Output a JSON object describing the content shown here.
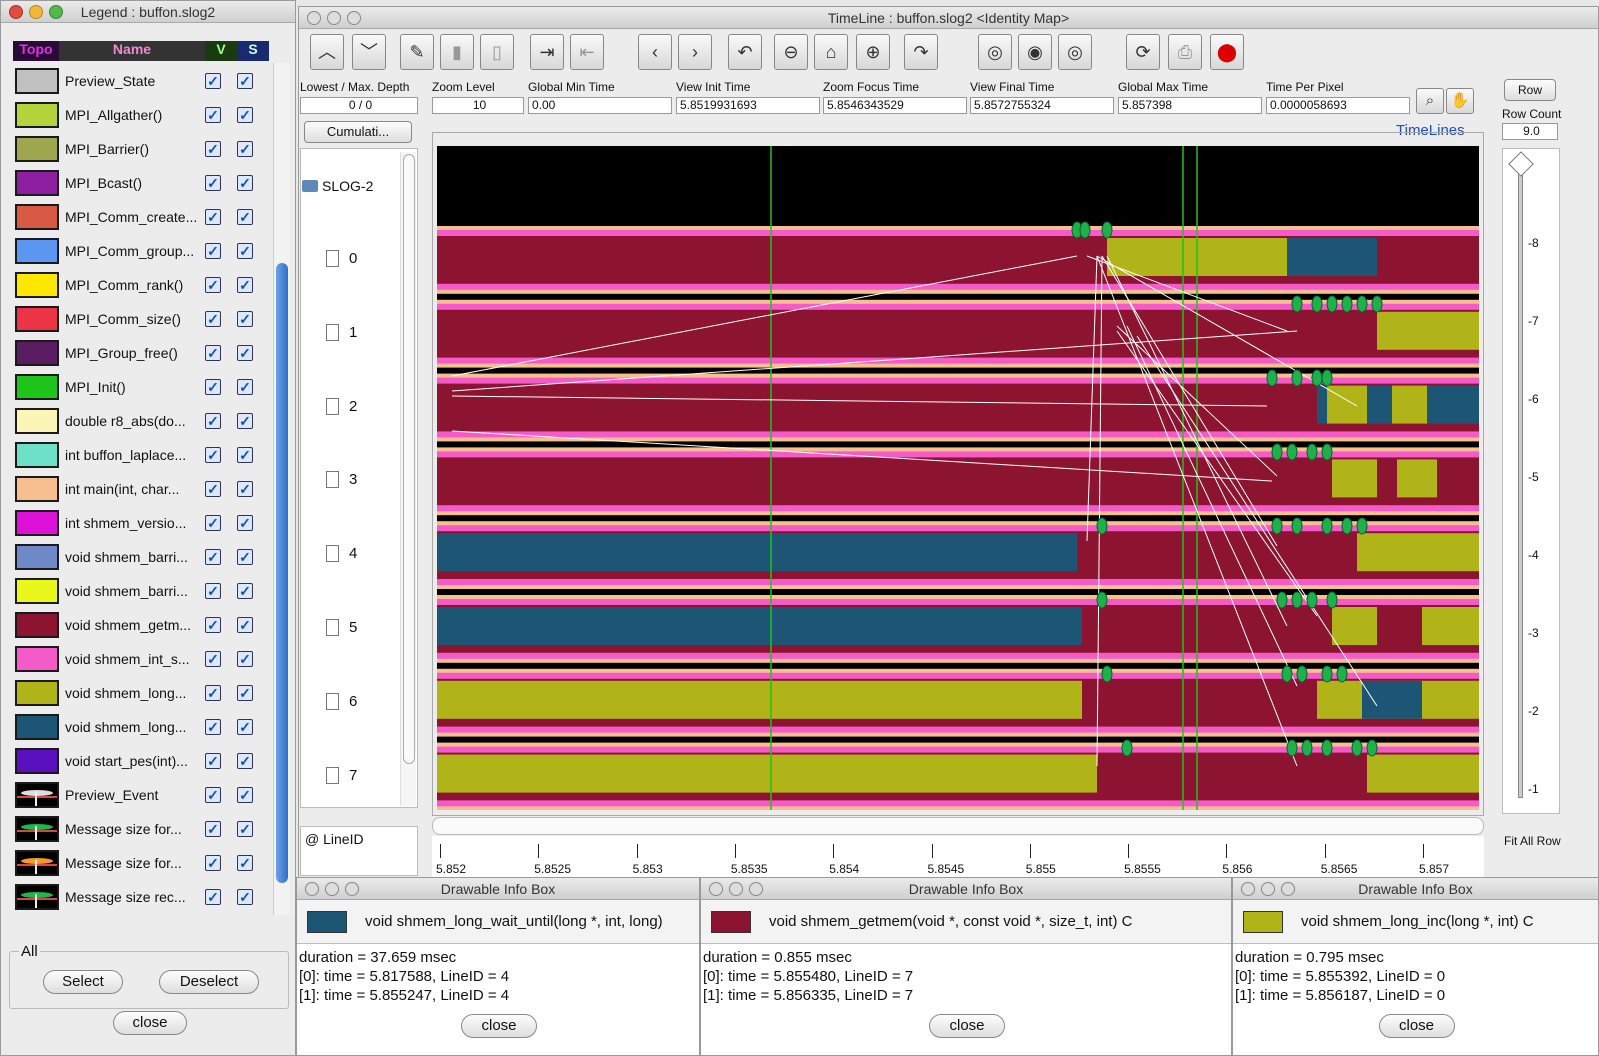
{
  "legend_window": {
    "title": "Legend : buffon.slog2",
    "col_topo": "Topo",
    "col_name": "Name",
    "col_v": "V",
    "col_s": "S",
    "items": [
      {
        "label": "Preview_State",
        "color": "#c0c0c0"
      },
      {
        "label": "MPI_Allgather()",
        "color": "#b5d33a"
      },
      {
        "label": "MPI_Barrier()",
        "color": "#9ea74e"
      },
      {
        "label": "MPI_Bcast()",
        "color": "#8e1fa0"
      },
      {
        "label": "MPI_Comm_create...",
        "color": "#d85a45"
      },
      {
        "label": "MPI_Comm_group...",
        "color": "#5b96f2"
      },
      {
        "label": "MPI_Comm_rank()",
        "color": "#ffe600"
      },
      {
        "label": "MPI_Comm_size()",
        "color": "#ec3447"
      },
      {
        "label": "MPI_Group_free()",
        "color": "#5a1d62"
      },
      {
        "label": "MPI_Init()",
        "color": "#1ec41a"
      },
      {
        "label": "double r8_abs(do...",
        "color": "#fbf6b8"
      },
      {
        "label": "int buffon_laplace...",
        "color": "#6fe0c8"
      },
      {
        "label": "int main(int, char...",
        "color": "#f7bf90"
      },
      {
        "label": "int shmem_versio...",
        "color": "#dd10d8"
      },
      {
        "label": "void shmem_barri...",
        "color": "#6f88c8"
      },
      {
        "label": "void shmem_barri...",
        "color": "#e9f71b"
      },
      {
        "label": "void shmem_getm...",
        "color": "#8c1430"
      },
      {
        "label": "void shmem_int_s...",
        "color": "#f45bc8"
      },
      {
        "label": "void shmem_long...",
        "color": "#b0b419"
      },
      {
        "label": "void shmem_long...",
        "color": "#1c5674"
      },
      {
        "label": "void start_pes(int)...",
        "color": "#5b10c0"
      },
      {
        "label": "Preview_Event",
        "color": "event-white"
      },
      {
        "label": "Message size for...",
        "color": "event-green"
      },
      {
        "label": "Message size for...",
        "color": "event-orange"
      },
      {
        "label": "Message size rec...",
        "color": "event-green2"
      }
    ],
    "all_label": "All",
    "select_label": "Select",
    "deselect_label": "Deselect",
    "close_label": "close"
  },
  "timeline_window": {
    "title": "TimeLine : buffon.slog2  <Identity Map>",
    "headers": {
      "depth": "Lowest / Max. Depth",
      "zoom": "Zoom Level",
      "gmin": "Global Min Time",
      "vinit": "View  Init Time",
      "zfocus": "Zoom Focus Time",
      "vfinal": "View Final Time",
      "gmax": "Global Max Time",
      "tpp": "Time Per Pixel"
    },
    "values": {
      "depth": "0 / 0",
      "zoom": "10",
      "gmin": "0.00",
      "vinit": "5.8519931693",
      "zfocus": "5.8546343529",
      "vfinal": "5.8572755324",
      "gmax": "5.857398",
      "tpp": "0.0000058693"
    },
    "row_label": "Row",
    "row_count_label": "Row Count",
    "row_count": "9.0",
    "cumulative": "Cumulati...",
    "timelines_label": "TimeLines",
    "tree_root": "SLOG-2",
    "rows": [
      "0",
      "1",
      "2",
      "3",
      "4",
      "5",
      "6",
      "7"
    ],
    "lineid_label": "@ LineID",
    "fit_all_rows": "Fit All Row",
    "axis_ticks": [
      "5.852",
      "5.8525",
      "5.853",
      "5.8535",
      "5.854",
      "5.8545",
      "5.855",
      "5.8555",
      "5.856",
      "5.8565",
      "5.857"
    ],
    "y_ticks": [
      "-8",
      "-7",
      "-6",
      "-5",
      "-4",
      "-3",
      "-2",
      "-1"
    ]
  },
  "info_boxes": [
    {
      "title": "Drawable Info Box",
      "name": "void shmem_long_wait_until(long *, int, long)",
      "color": "#1c5674",
      "duration": "duration = 37.659 msec",
      "line0": "[0]: time = 5.817588, LineID = 4",
      "line1": "[1]: time = 5.855247, LineID = 4",
      "close": "close"
    },
    {
      "title": "Drawable Info Box",
      "name": "void shmem_getmem(void *, const void *, size_t, int) C",
      "color": "#8c1430",
      "duration": "duration = 0.855 msec",
      "line0": "[0]: time = 5.855480, LineID = 7",
      "line1": "[1]: time = 5.856335, LineID = 7",
      "close": "close"
    },
    {
      "title": "Drawable Info Box",
      "name": "void shmem_long_inc(long *, int) C",
      "color": "#b0b419",
      "duration": "duration = 0.795 msec",
      "line0": "[0]: time = 5.855392, LineID = 0",
      "line1": "[1]: time = 5.856187, LineID = 0",
      "close": "close"
    }
  ]
}
